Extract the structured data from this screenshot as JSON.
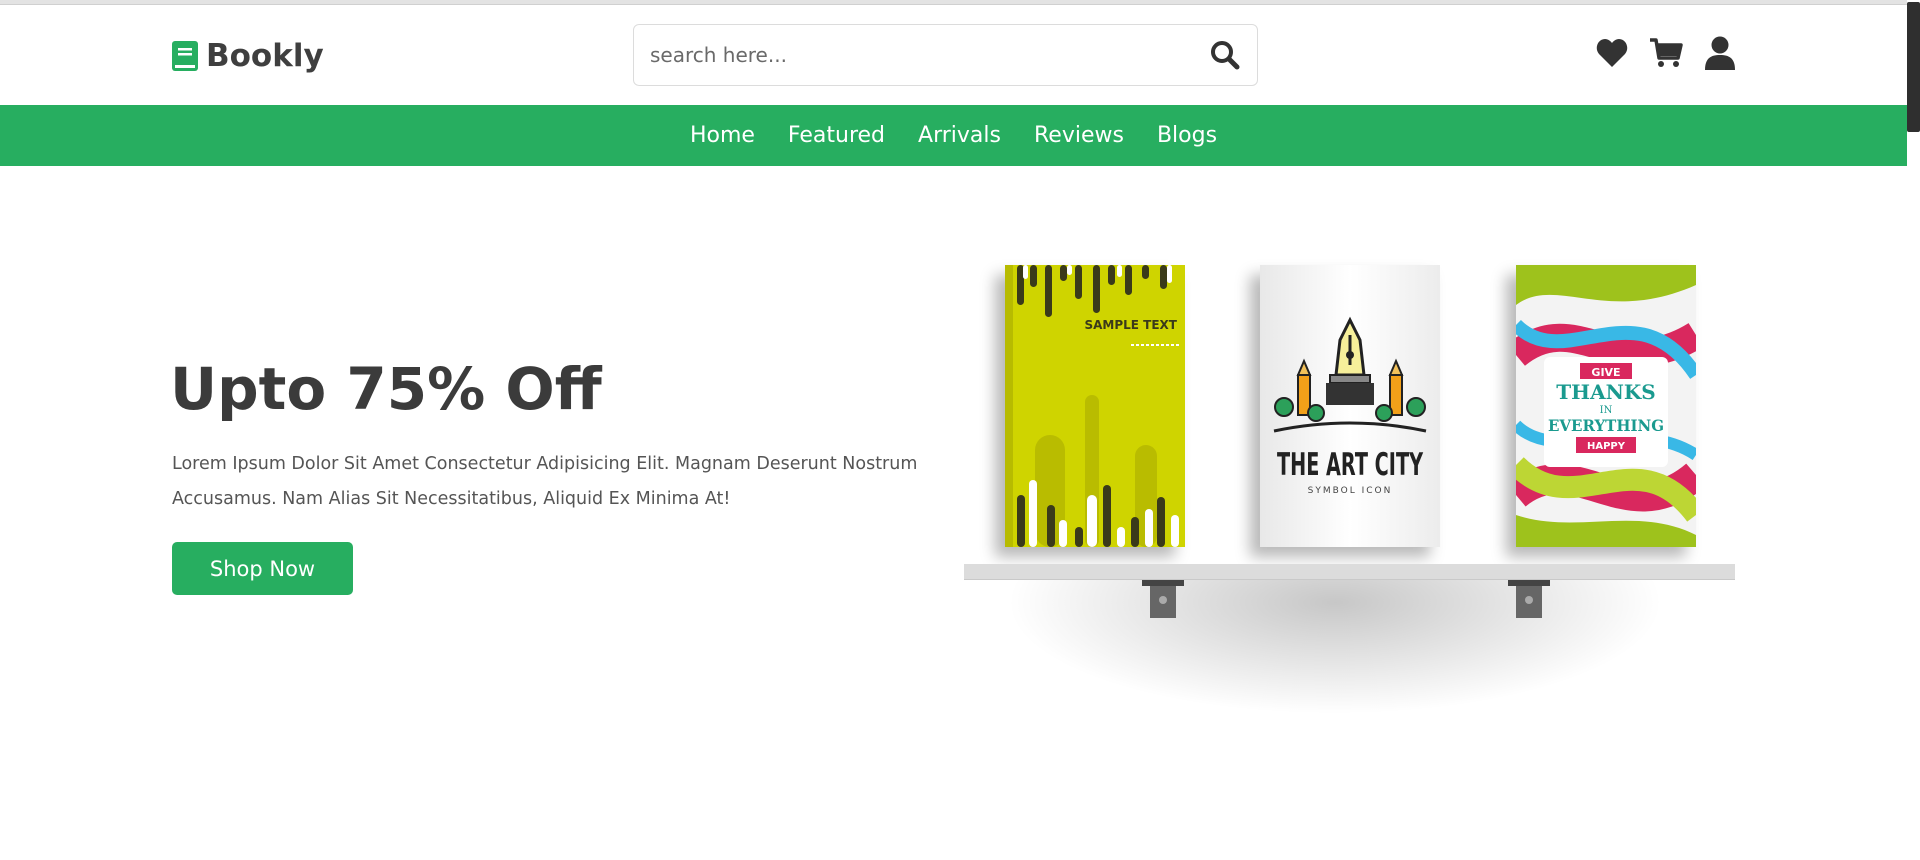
{
  "brand": {
    "name": "Bookly",
    "icon": "book-icon",
    "color": "#27ae60"
  },
  "search": {
    "placeholder": "search here...",
    "icon": "search-icon"
  },
  "header_icons": [
    "heart-icon",
    "cart-icon",
    "user-icon"
  ],
  "nav": {
    "items": [
      {
        "label": "Home"
      },
      {
        "label": "Featured"
      },
      {
        "label": "Arrivals"
      },
      {
        "label": "Reviews"
      },
      {
        "label": "Blogs"
      }
    ]
  },
  "hero": {
    "title": "Upto 75% Off",
    "description": "Lorem Ipsum Dolor Sit Amet Consectetur Adipisicing Elit. Magnam Deserunt Nostrum Accusamus. Nam Alias Sit Necessitatibus, Aliquid Ex Minima At!",
    "button": "Shop Now"
  },
  "books": [
    {
      "cover_text": "SAMPLE TEXT"
    },
    {
      "cover_title": "THE ART CITY",
      "cover_subtitle": "SYMBOL ICON"
    },
    {
      "cover_top": "GIVE",
      "cover_line1": "THANKS",
      "cover_line2": "IN",
      "cover_line3": "EVERYTHING",
      "cover_bottom": "HAPPY"
    }
  ]
}
